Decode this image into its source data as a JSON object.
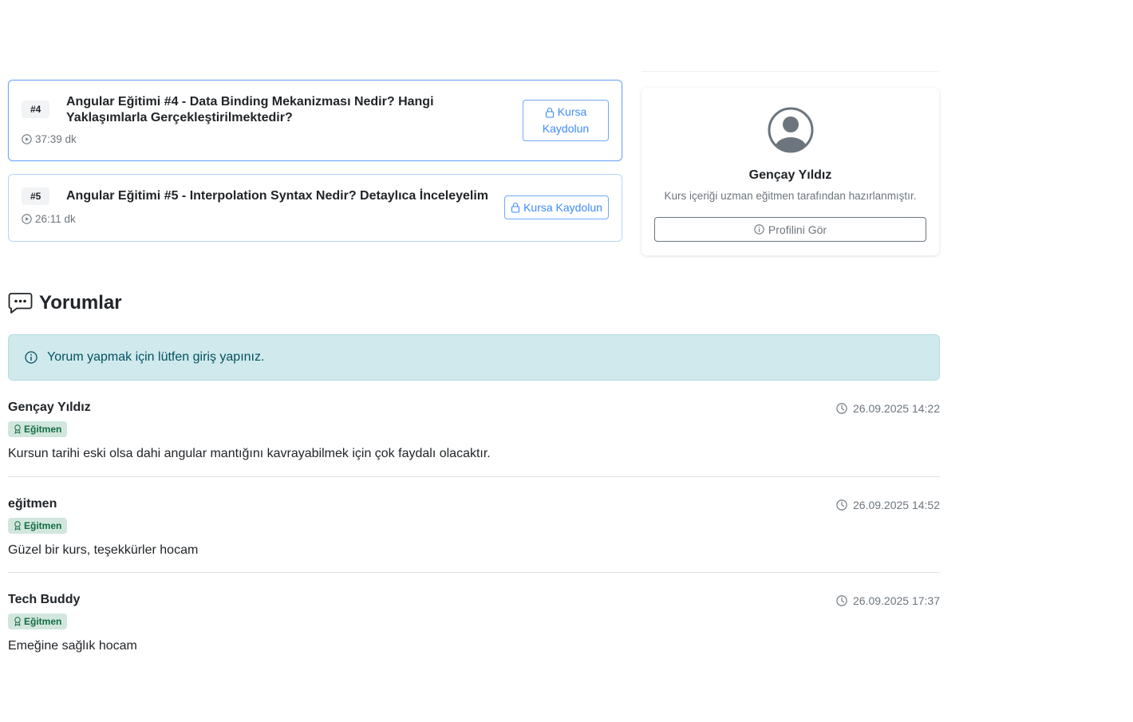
{
  "lessons": [
    {
      "number": "#4",
      "title": "Angular Eğitimi #4 - Data Binding Mekanizması Nedir? Hangi Yaklaşımlarla Gerçekleştirilmektedir?",
      "duration": "37:39 dk",
      "enroll_line1": "Kursa",
      "enroll_line2": "Kaydolun"
    },
    {
      "number": "#5",
      "title": "Angular Eğitimi #5 - Interpolation Syntax Nedir? Detaylıca İnceleyelim",
      "duration": "26:11 dk",
      "enroll_label": "Kursa Kaydolun"
    }
  ],
  "instructor": {
    "name": "Gençay Yıldız",
    "description": "Kurs içeriği uzman eğitmen tarafından hazırlanmıştır.",
    "profile_button": "Profilini Gör"
  },
  "comments_section": {
    "heading": "Yorumlar",
    "login_alert": "Yorum yapmak için lütfen giriş yapınız.",
    "comments": [
      {
        "author": "Gençay Yıldız",
        "role": "Eğitmen",
        "date": "26.09.2025 14:22",
        "text": "Kursun tarihi eski olsa dahi angular mantığını kavrayabilmek için çok faydalı olacaktır."
      },
      {
        "author": "eğitmen",
        "role": "Eğitmen",
        "date": "26.09.2025 14:52",
        "text": "Güzel bir kurs, teşekkürler hocam"
      },
      {
        "author": "Tech Buddy",
        "role": "Eğitmen",
        "date": "26.09.2025 17:37",
        "text": "Emeğine sağlık hocam"
      }
    ]
  },
  "icons": {
    "duration": "play-circle-icon",
    "enroll": "lock-icon",
    "avatar": "person-circle-icon",
    "profile": "info-circle-icon",
    "comments": "chat-dots-icon",
    "alert": "info-circle-icon",
    "role": "award-icon",
    "date": "clock-icon"
  },
  "colors": {
    "primary_outline": "#6ea8fe",
    "alert_bg": "#cfe9ed",
    "badge_success_bg": "#d1e7dd",
    "badge_success_text": "#146c43"
  }
}
